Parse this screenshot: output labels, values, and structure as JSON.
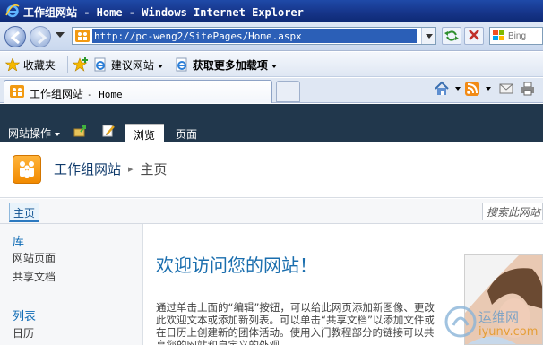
{
  "window": {
    "title": "工作组网站 - Home - Windows Internet Explorer"
  },
  "address_bar": {
    "url": "http://pc-weng2/SitePages/Home.aspx",
    "search_placeholder": "Bing"
  },
  "favorites_bar": {
    "favorites_label": "收藏夹",
    "items": [
      {
        "label": "建议网站"
      },
      {
        "label": "获取更多加载项"
      }
    ]
  },
  "tabs": [
    {
      "title": "工作组网站",
      "suffix": "- Home"
    }
  ],
  "ribbon": {
    "site_actions": "网站操作",
    "tabs": [
      {
        "label": "浏览",
        "active": true
      },
      {
        "label": "页面",
        "active": false
      }
    ]
  },
  "site_header": {
    "site_name": "工作组网站",
    "current_page": "主页"
  },
  "top_nav": {
    "items": [
      {
        "label": "主页"
      }
    ],
    "search_placeholder": "搜索此网站"
  },
  "quick_launch": {
    "sections": [
      {
        "heading": "库",
        "items": [
          "网站页面",
          "共享文档"
        ]
      },
      {
        "heading": "列表",
        "items": [
          "日历"
        ]
      }
    ]
  },
  "main": {
    "welcome_title": "欢迎访问您的网站！",
    "body_text": "通过单击上面的“编辑”按钮，可以给此网页添加新图像、更改此欢迎文本或添加新列表。可以单击“共享文档”以添加文件或在日历上创建新的团体活动。使用入门教程部分的链接可以共享您的网站和自定义的外观。"
  },
  "watermark": {
    "line1": "运维网",
    "line2": "iyunv.com"
  },
  "colors": {
    "ribbon_bg": "#21374c",
    "link_blue": "#1a6eae",
    "title_bar": "#16358a"
  }
}
